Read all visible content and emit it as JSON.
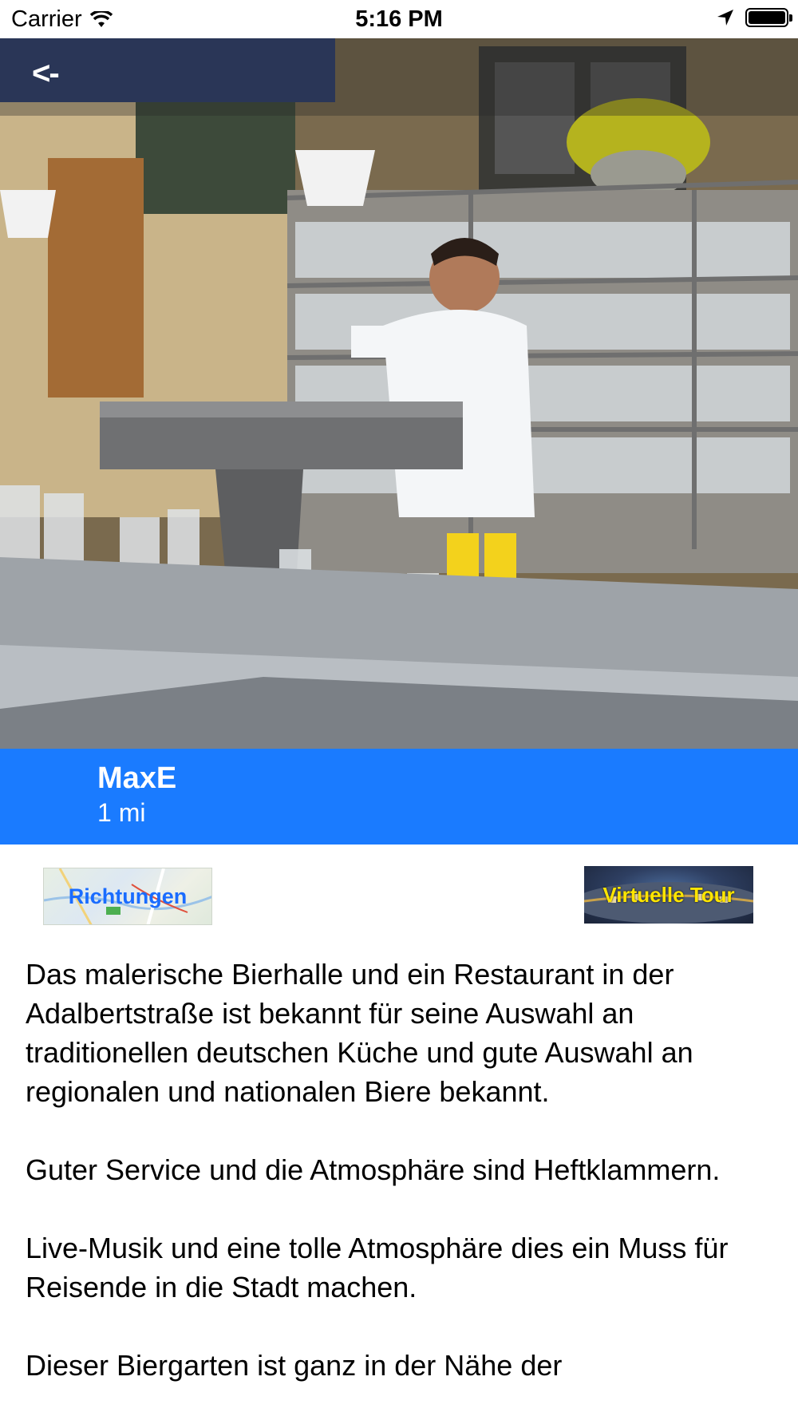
{
  "status_bar": {
    "carrier": "Carrier",
    "time": "5:16 PM"
  },
  "nav": {
    "back_label": "<-"
  },
  "place": {
    "name": "MaxE",
    "distance": "1 mi"
  },
  "actions": {
    "directions_label": "Richtungen",
    "tour_label": "Virtuelle Tour"
  },
  "description": {
    "paragraphs": [
      "Das malerische Bierhalle und ein Restaurant in der Adalbertstraße ist bekannt für seine Auswahl an traditionellen deutschen Küche und gute Auswahl an regionalen und nationalen Biere bekannt.",
      "Guter Service und die Atmosphäre sind Heftklammern.",
      "Live-Musik und eine tolle Atmosphäre dies ein Muss für Reisende in die Stadt machen.",
      "Dieser Biergarten ist ganz in der Nähe der"
    ]
  },
  "colors": {
    "accent_blue": "#1a7bff",
    "tour_text": "#ffe600",
    "directions_text": "#1a6cff"
  },
  "icons": [
    "wifi-icon",
    "location-arrow-icon",
    "battery-icon"
  ]
}
